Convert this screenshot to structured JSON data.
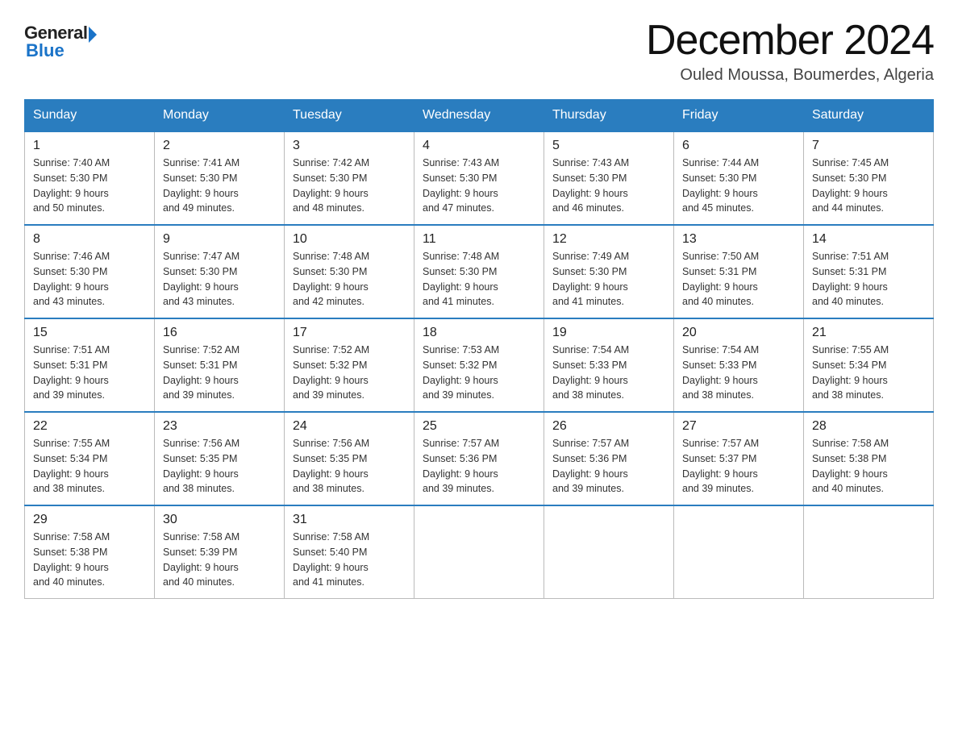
{
  "header": {
    "logo": {
      "general_text": "General",
      "blue_text": "Blue"
    },
    "title": "December 2024",
    "subtitle": "Ouled Moussa, Boumerdes, Algeria"
  },
  "days_of_week": [
    "Sunday",
    "Monday",
    "Tuesday",
    "Wednesday",
    "Thursday",
    "Friday",
    "Saturday"
  ],
  "weeks": [
    [
      {
        "day": "1",
        "sunrise": "7:40 AM",
        "sunset": "5:30 PM",
        "daylight": "9 hours and 50 minutes."
      },
      {
        "day": "2",
        "sunrise": "7:41 AM",
        "sunset": "5:30 PM",
        "daylight": "9 hours and 49 minutes."
      },
      {
        "day": "3",
        "sunrise": "7:42 AM",
        "sunset": "5:30 PM",
        "daylight": "9 hours and 48 minutes."
      },
      {
        "day": "4",
        "sunrise": "7:43 AM",
        "sunset": "5:30 PM",
        "daylight": "9 hours and 47 minutes."
      },
      {
        "day": "5",
        "sunrise": "7:43 AM",
        "sunset": "5:30 PM",
        "daylight": "9 hours and 46 minutes."
      },
      {
        "day": "6",
        "sunrise": "7:44 AM",
        "sunset": "5:30 PM",
        "daylight": "9 hours and 45 minutes."
      },
      {
        "day": "7",
        "sunrise": "7:45 AM",
        "sunset": "5:30 PM",
        "daylight": "9 hours and 44 minutes."
      }
    ],
    [
      {
        "day": "8",
        "sunrise": "7:46 AM",
        "sunset": "5:30 PM",
        "daylight": "9 hours and 43 minutes."
      },
      {
        "day": "9",
        "sunrise": "7:47 AM",
        "sunset": "5:30 PM",
        "daylight": "9 hours and 43 minutes."
      },
      {
        "day": "10",
        "sunrise": "7:48 AM",
        "sunset": "5:30 PM",
        "daylight": "9 hours and 42 minutes."
      },
      {
        "day": "11",
        "sunrise": "7:48 AM",
        "sunset": "5:30 PM",
        "daylight": "9 hours and 41 minutes."
      },
      {
        "day": "12",
        "sunrise": "7:49 AM",
        "sunset": "5:30 PM",
        "daylight": "9 hours and 41 minutes."
      },
      {
        "day": "13",
        "sunrise": "7:50 AM",
        "sunset": "5:31 PM",
        "daylight": "9 hours and 40 minutes."
      },
      {
        "day": "14",
        "sunrise": "7:51 AM",
        "sunset": "5:31 PM",
        "daylight": "9 hours and 40 minutes."
      }
    ],
    [
      {
        "day": "15",
        "sunrise": "7:51 AM",
        "sunset": "5:31 PM",
        "daylight": "9 hours and 39 minutes."
      },
      {
        "day": "16",
        "sunrise": "7:52 AM",
        "sunset": "5:31 PM",
        "daylight": "9 hours and 39 minutes."
      },
      {
        "day": "17",
        "sunrise": "7:52 AM",
        "sunset": "5:32 PM",
        "daylight": "9 hours and 39 minutes."
      },
      {
        "day": "18",
        "sunrise": "7:53 AM",
        "sunset": "5:32 PM",
        "daylight": "9 hours and 39 minutes."
      },
      {
        "day": "19",
        "sunrise": "7:54 AM",
        "sunset": "5:33 PM",
        "daylight": "9 hours and 38 minutes."
      },
      {
        "day": "20",
        "sunrise": "7:54 AM",
        "sunset": "5:33 PM",
        "daylight": "9 hours and 38 minutes."
      },
      {
        "day": "21",
        "sunrise": "7:55 AM",
        "sunset": "5:34 PM",
        "daylight": "9 hours and 38 minutes."
      }
    ],
    [
      {
        "day": "22",
        "sunrise": "7:55 AM",
        "sunset": "5:34 PM",
        "daylight": "9 hours and 38 minutes."
      },
      {
        "day": "23",
        "sunrise": "7:56 AM",
        "sunset": "5:35 PM",
        "daylight": "9 hours and 38 minutes."
      },
      {
        "day": "24",
        "sunrise": "7:56 AM",
        "sunset": "5:35 PM",
        "daylight": "9 hours and 38 minutes."
      },
      {
        "day": "25",
        "sunrise": "7:57 AM",
        "sunset": "5:36 PM",
        "daylight": "9 hours and 39 minutes."
      },
      {
        "day": "26",
        "sunrise": "7:57 AM",
        "sunset": "5:36 PM",
        "daylight": "9 hours and 39 minutes."
      },
      {
        "day": "27",
        "sunrise": "7:57 AM",
        "sunset": "5:37 PM",
        "daylight": "9 hours and 39 minutes."
      },
      {
        "day": "28",
        "sunrise": "7:58 AM",
        "sunset": "5:38 PM",
        "daylight": "9 hours and 40 minutes."
      }
    ],
    [
      {
        "day": "29",
        "sunrise": "7:58 AM",
        "sunset": "5:38 PM",
        "daylight": "9 hours and 40 minutes."
      },
      {
        "day": "30",
        "sunrise": "7:58 AM",
        "sunset": "5:39 PM",
        "daylight": "9 hours and 40 minutes."
      },
      {
        "day": "31",
        "sunrise": "7:58 AM",
        "sunset": "5:40 PM",
        "daylight": "9 hours and 41 minutes."
      },
      null,
      null,
      null,
      null
    ]
  ],
  "labels": {
    "sunrise": "Sunrise:",
    "sunset": "Sunset:",
    "daylight": "Daylight:"
  }
}
